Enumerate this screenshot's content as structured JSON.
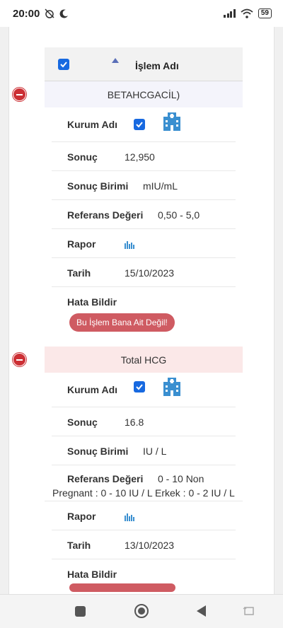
{
  "status": {
    "time": "20:00",
    "battery": "59"
  },
  "table": {
    "header_label": "İşlem Adı",
    "groups": [
      {
        "name": "BETAHCGACİL)",
        "kurum_label": "Kurum Adı",
        "sonuc_label": "Sonuç",
        "sonuc_value": "12,950",
        "birim_label": "Sonuç Birimi",
        "birim_value": "mIU/mL",
        "ref_label": "Referans Değeri",
        "ref_value": "0,50 - 5,0",
        "rapor_label": "Rapor",
        "tarih_label": "Tarih",
        "tarih_value": "15/10/2023",
        "hata_label": "Hata Bildir",
        "hata_button": "Bu İşlem Bana Ait Değil!"
      },
      {
        "name": "Total HCG",
        "kurum_label": "Kurum Adı",
        "sonuc_label": "Sonuç",
        "sonuc_value": "16.8",
        "birim_label": "Sonuç Birimi",
        "birim_value": "IU / L",
        "ref_label": "Referans Değeri",
        "ref_value_line1": "0 - 10 Non",
        "ref_value_line2": "Pregnant : 0 - 10 IU / L Erkek : 0 - 2 IU / L",
        "rapor_label": "Rapor",
        "tarih_label": "Tarih",
        "tarih_value": "13/10/2023",
        "hata_label": "Hata Bildir"
      }
    ]
  },
  "icons": {
    "checkbox": "checkbox-checked-icon",
    "sort": "sort-asc-icon",
    "collapse": "minus-circle-icon",
    "institution": "hospital-building-icon",
    "report": "bar-chart-icon"
  },
  "colors": {
    "primary": "#1769e0",
    "danger": "#cc2f34",
    "button": "#cf5b62",
    "hospital": "#3a8fd0"
  }
}
